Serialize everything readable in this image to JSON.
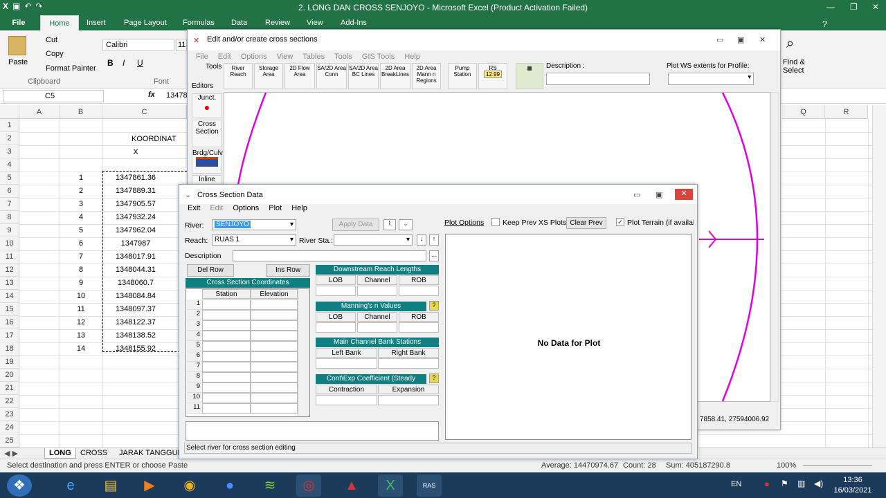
{
  "excel": {
    "title": "2. LONG DAN CROSS SENJOYO  -  Microsoft Excel (Product Activation Failed)",
    "tabs": [
      "Insert",
      "Page Layout",
      "Formulas",
      "Data",
      "Review",
      "View",
      "Add-Ins"
    ],
    "file_tab": "File",
    "home_tab": "Home",
    "clipboard": {
      "cut": "Cut",
      "copy": "Copy",
      "format_painter": "Format Painter",
      "paste": "Paste",
      "group": "Clipboard"
    },
    "font": {
      "name": "Calibri",
      "size": "11",
      "group": "Font"
    },
    "find_select": "Find & Select",
    "name_box": "C5",
    "formula_value": "13478",
    "columns": [
      "A",
      "B",
      "C",
      "Q",
      "R"
    ],
    "header_text": "KOORDINAT",
    "x_label": "X",
    "rows": [
      {
        "n": "1",
        "b": "",
        "c": ""
      },
      {
        "n": "2",
        "b": "",
        "c": ""
      },
      {
        "n": "3",
        "b": "",
        "c": ""
      },
      {
        "n": "4",
        "b": "",
        "c": ""
      },
      {
        "n": "5",
        "b": "1",
        "c": "1347861.36"
      },
      {
        "n": "6",
        "b": "2",
        "c": "1347889.31"
      },
      {
        "n": "7",
        "b": "3",
        "c": "1347905.57"
      },
      {
        "n": "8",
        "b": "4",
        "c": "1347932.24"
      },
      {
        "n": "9",
        "b": "5",
        "c": "1347962.04"
      },
      {
        "n": "10",
        "b": "6",
        "c": "1347987"
      },
      {
        "n": "11",
        "b": "7",
        "c": "1348017.91"
      },
      {
        "n": "12",
        "b": "8",
        "c": "1348044.31"
      },
      {
        "n": "13",
        "b": "9",
        "c": "1348060.7"
      },
      {
        "n": "14",
        "b": "10",
        "c": "1348084.84"
      },
      {
        "n": "15",
        "b": "11",
        "c": "1348097.37"
      },
      {
        "n": "16",
        "b": "12",
        "c": "1348122.37"
      },
      {
        "n": "17",
        "b": "13",
        "c": "1348138.52"
      },
      {
        "n": "18",
        "b": "14",
        "c": "1348155.92"
      },
      {
        "n": "19",
        "b": "",
        "c": ""
      },
      {
        "n": "20",
        "b": "",
        "c": ""
      },
      {
        "n": "21",
        "b": "",
        "c": ""
      },
      {
        "n": "22",
        "b": "",
        "c": ""
      },
      {
        "n": "23",
        "b": "",
        "c": ""
      },
      {
        "n": "24",
        "b": "",
        "c": ""
      },
      {
        "n": "25",
        "b": "",
        "c": ""
      }
    ],
    "sheet_tabs": [
      "LONG",
      "CROSS",
      "JARAK TANGGUL"
    ],
    "status_left": "Select destination and press ENTER or choose Paste",
    "average": "Average: 14470974.67",
    "count": "Count: 28",
    "sum": "Sum: 405187290.8",
    "zoom": "100%"
  },
  "geometry": {
    "title": "Edit and/or create cross sections",
    "menu": [
      "File",
      "Edit",
      "Options",
      "View",
      "Tables",
      "Tools",
      "GIS Tools",
      "Help"
    ],
    "tools_label": "Tools",
    "editors_label": "Editors",
    "tools": [
      "River Reach",
      "Storage Area",
      "2D Flow Area",
      "SA/2D Area Conn",
      "SA/2D Area BC Lines",
      "2D Area BreakLines",
      "2D Area Mann n Regions",
      "Pump Station",
      "RS"
    ],
    "rs_value": "12.99",
    "description_label": "Description :",
    "plot_ws_label": "Plot WS extents for Profile:",
    "editors": [
      "Junct.",
      "Cross Section",
      "Brdg/Culv",
      "Inline"
    ],
    "coord_readout": "7858.41, 27594006.92"
  },
  "xsd": {
    "title": "Cross Section Data",
    "menu": [
      "Exit",
      "Edit",
      "Options",
      "Plot",
      "Help"
    ],
    "river_label": "River:",
    "river_value": "SENJOYO",
    "reach_label": "Reach:",
    "reach_value": "RUAS 1",
    "river_sta_label": "River Sta.:",
    "apply_data": "Apply Data",
    "description_label": "Description",
    "del_row": "Del Row",
    "ins_row": "Ins Row",
    "coords_title": "Cross Section Coordinates",
    "station": "Station",
    "elevation": "Elevation",
    "row_numbers": [
      "1",
      "2",
      "3",
      "4",
      "5",
      "6",
      "7",
      "8",
      "9",
      "10",
      "11"
    ],
    "downstream_title": "Downstream Reach Lengths",
    "lob": "LOB",
    "channel": "Channel",
    "rob": "ROB",
    "manning_title": "Manning's n Values",
    "bank_title": "Main Channel Bank Stations",
    "left_bank": "Left Bank",
    "right_bank": "Right Bank",
    "cont_title": "Cont\\Exp Coefficient (Steady",
    "contraction": "Contraction",
    "expansion": "Expansion",
    "plot_options": "Plot Options",
    "keep_prev": "Keep Prev XS Plots",
    "clear_prev": "Clear Prev",
    "plot_terrain": "Plot Terrain (if availab",
    "no_data": "No Data for Plot",
    "status": "Select river for cross section editing"
  },
  "taskbar": {
    "lang": "EN",
    "time": "13:36",
    "date": "16/03/2021"
  }
}
